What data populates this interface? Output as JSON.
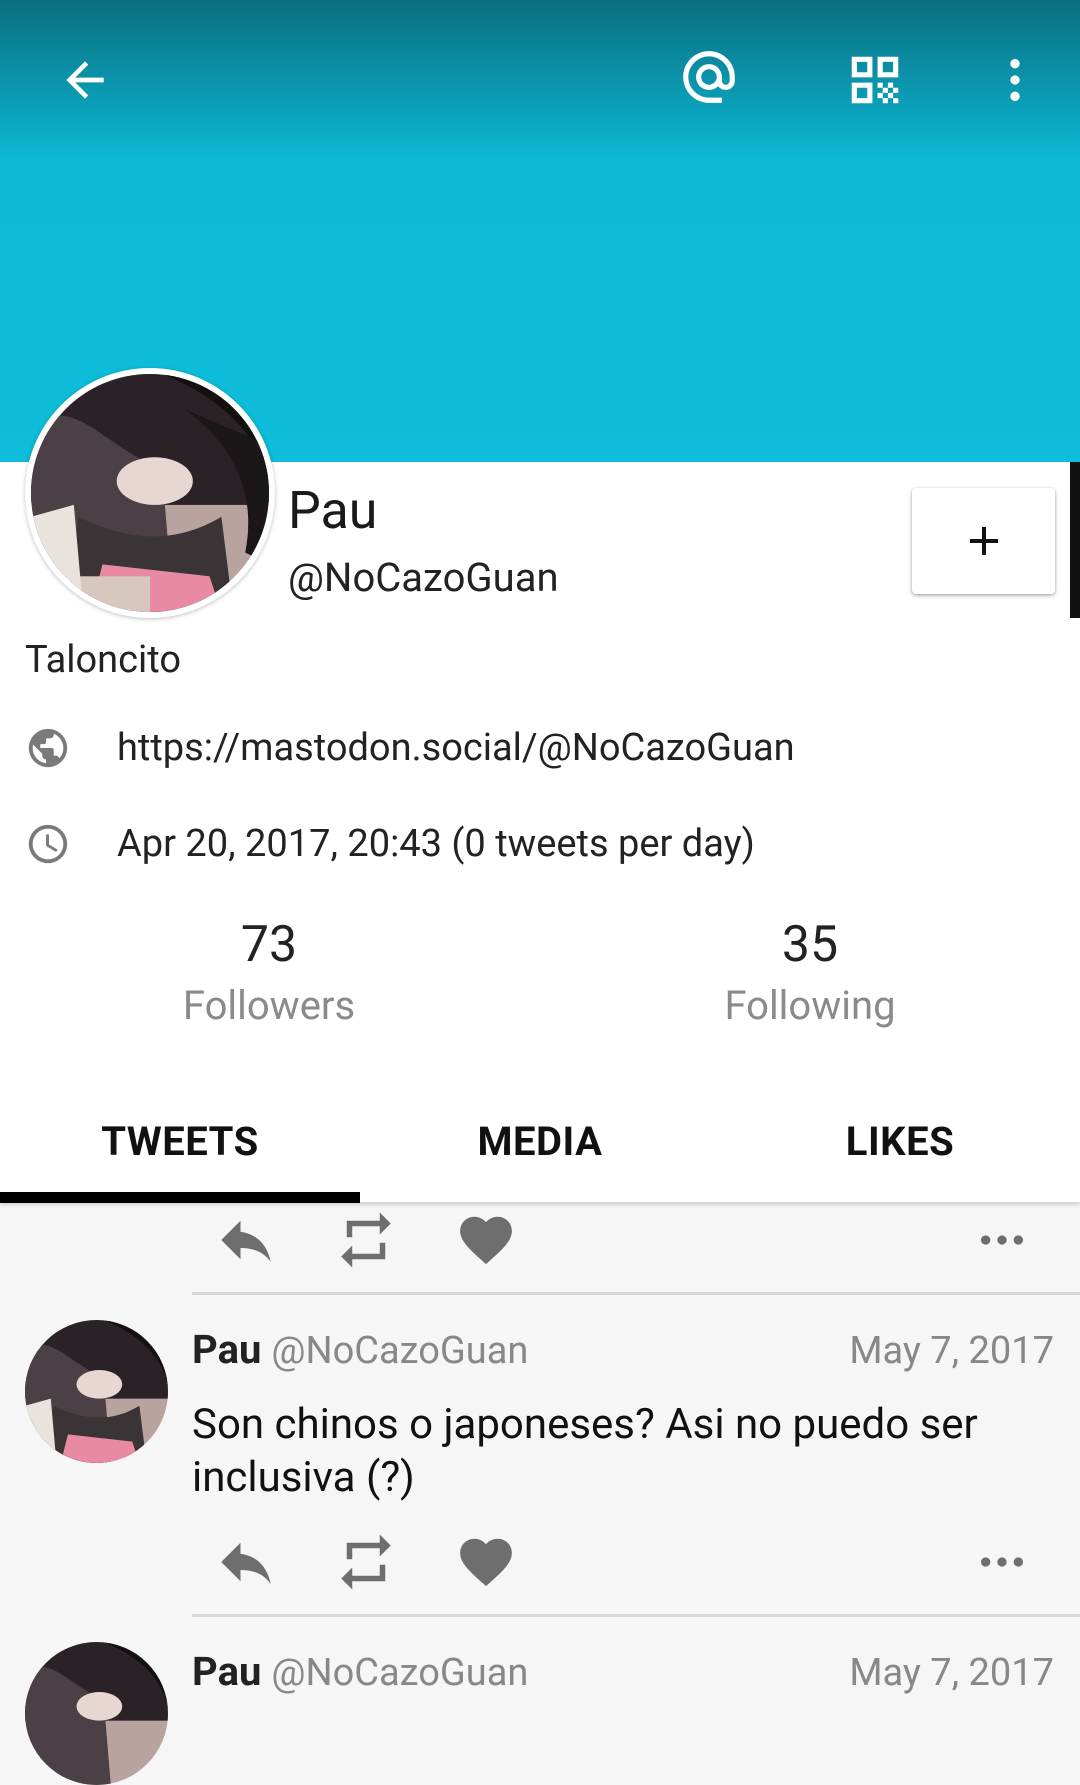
{
  "toolbar": {
    "icons": [
      "back-arrow-icon",
      "at-mention-icon",
      "qr-code-icon",
      "overflow-menu-icon"
    ],
    "banner_color": "#0dbdd9",
    "header_color": "#0a6f80"
  },
  "profile": {
    "display_name": "Pau",
    "username": "@NoCazoGuan",
    "bio": "Taloncito",
    "url": "https://mastodon.social/@NoCazoGuan",
    "joined": "Apr 20, 2017, 20:43 (0 tweets per day)",
    "follow_button": "+",
    "followers_count": "73",
    "followers_label": "Followers",
    "following_count": "35",
    "following_label": "Following"
  },
  "tabs": [
    {
      "label": "TWEETS",
      "selected": true
    },
    {
      "label": "MEDIA",
      "selected": false
    },
    {
      "label": "LIKES",
      "selected": false
    }
  ],
  "actions": {
    "icons": [
      "reply-icon",
      "boost-icon",
      "favourite-icon",
      "more-icon"
    ],
    "icon_color": "#6e6e6e"
  },
  "statuses": [
    {
      "name": "Pau",
      "acct": "@NoCazoGuan",
      "date": "May 7, 2017",
      "text": "Son chinos o japoneses? Asi no puedo ser inclusiva (?)"
    },
    {
      "name": "Pau",
      "acct": "@NoCazoGuan",
      "date": "May 7, 2017",
      "text": ""
    }
  ]
}
